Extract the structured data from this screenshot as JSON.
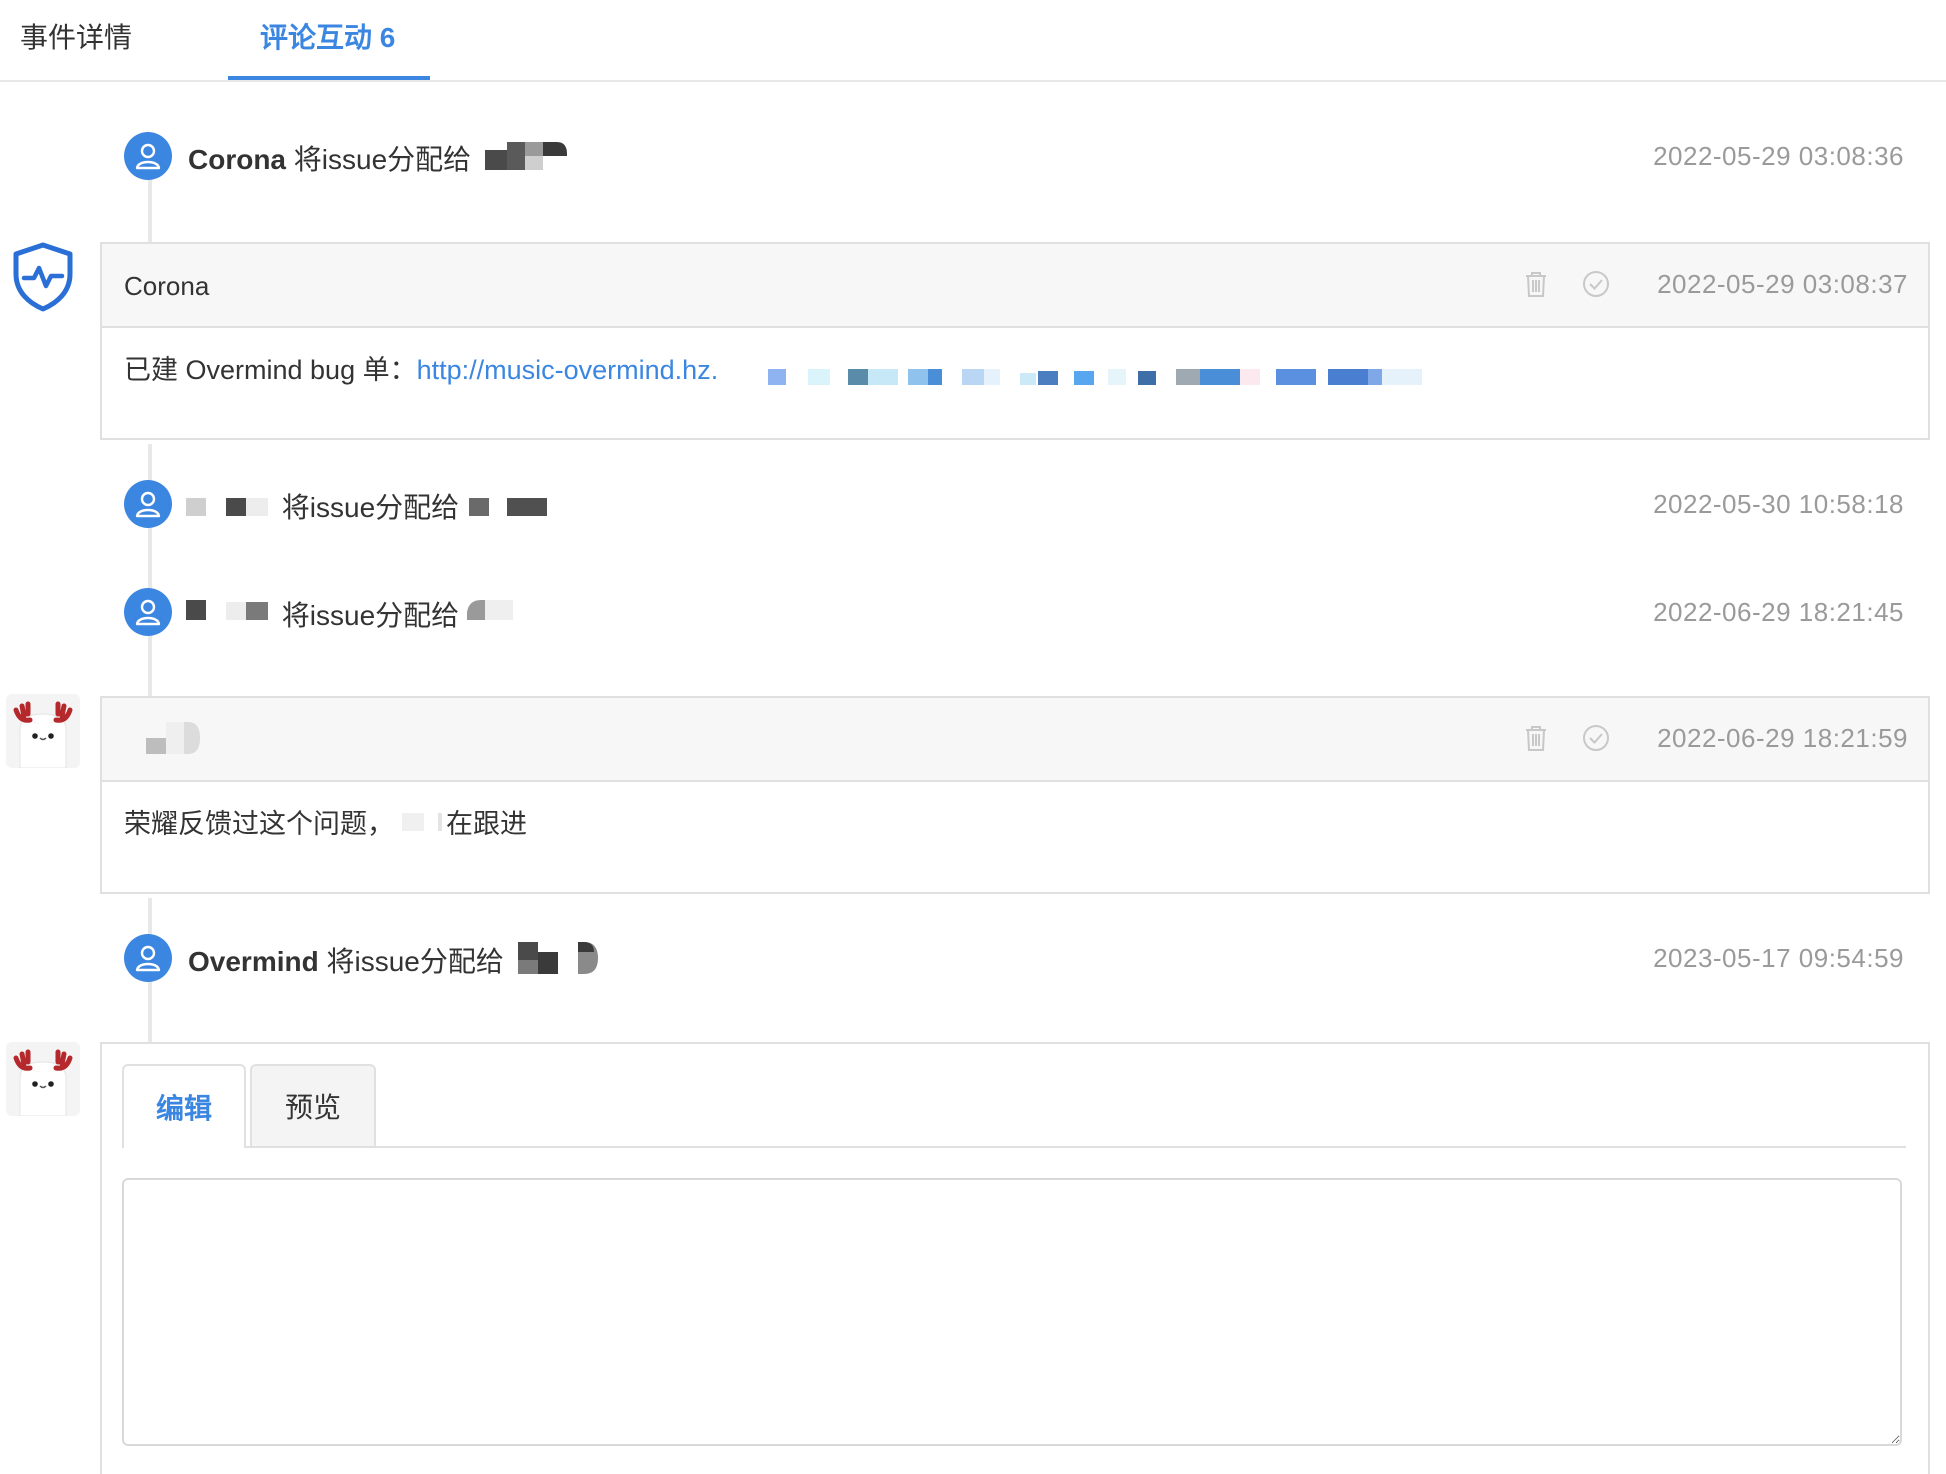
{
  "tabs": [
    {
      "label": "事件详情",
      "active": false
    },
    {
      "label": "评论互动 6",
      "active": true
    }
  ],
  "events": [
    {
      "actor": "Corona",
      "action": "将issue分配给",
      "timestamp": "2022-05-29 03:08:36"
    },
    {
      "actor": "",
      "action": "将issue分配给",
      "timestamp": "2022-05-30 10:58:18"
    },
    {
      "actor": "",
      "action": "将issue分配给",
      "timestamp": "2022-06-29 18:21:45"
    },
    {
      "actor": "Overmind",
      "action": "将issue分配给",
      "timestamp": "2023-05-17 09:54:59"
    }
  ],
  "comments": [
    {
      "author": "Corona",
      "timestamp": "2022-05-29 03:08:37",
      "body_prefix": "已建 Overmind bug 单：",
      "body_link": "http://music-overmind.hz."
    },
    {
      "author": "",
      "timestamp": "2022-06-29 18:21:59",
      "body_prefix": "荣耀反馈过这个问题，",
      "body_suffix": "在跟进"
    }
  ],
  "editor": {
    "tabs": [
      {
        "label": "编辑",
        "active": true
      },
      {
        "label": "预览",
        "active": false
      }
    ],
    "value": ""
  },
  "icons": {
    "event_avatar": "user-icon",
    "bot_avatar": "shield-pulse-icon",
    "moose_avatar": "moose-avatar-icon",
    "delete": "trash-icon",
    "resolve": "check-circle-icon"
  },
  "colors": {
    "accent": "#3b86e0",
    "muted_text": "#9a9a9a",
    "border": "#e0e0e0"
  }
}
